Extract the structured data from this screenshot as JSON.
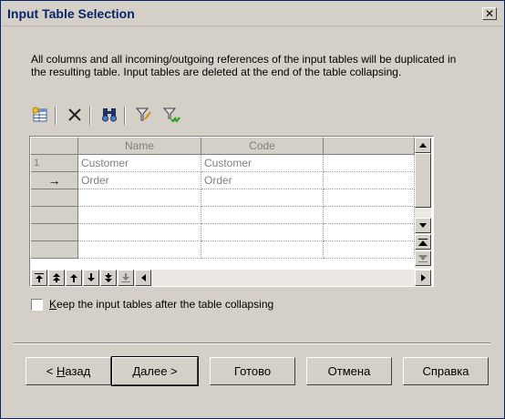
{
  "window": {
    "title": "Input Table Selection",
    "close_glyph": "✕"
  },
  "description": "All columns and all incoming/outgoing references of the input tables will be duplicated in the resulting table. Input tables are deleted at the end of the table collapsing.",
  "toolbar": {
    "items": [
      "add-tables-icon",
      "delete-icon",
      "find-icon",
      "filter-icon",
      "filter-check-icon"
    ]
  },
  "grid": {
    "columns": [
      "Name",
      "Code"
    ],
    "rows": [
      {
        "indicator": "1",
        "name": "Customer",
        "code": "Customer"
      },
      {
        "indicator": "→",
        "name": "Order",
        "code": "Order"
      }
    ],
    "empty_rows": 4
  },
  "checkbox": {
    "label_mnemonic": "K",
    "label_rest": "eep the input tables after the table collapsing",
    "checked": false
  },
  "buttons": {
    "back": {
      "prefix": "< ",
      "mnemonic": "Н",
      "rest": "азад"
    },
    "next": {
      "prefix": "",
      "mnemonic": "Д",
      "rest": "алее >"
    },
    "finish": "Готово",
    "cancel": "Отмена",
    "help": "Справка"
  },
  "colors": {
    "titlebar_text": "#0a246a",
    "dialog_bg": "#d4d0c8",
    "grid_text": "#808080"
  }
}
